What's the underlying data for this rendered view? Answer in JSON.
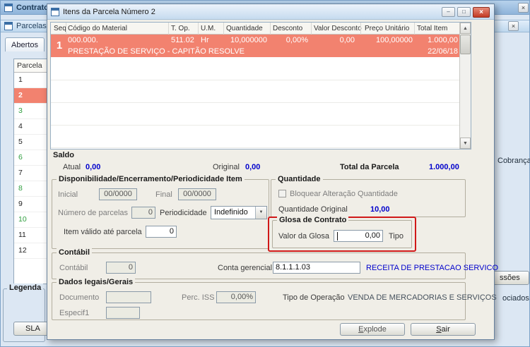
{
  "colors": {
    "selection_salmon": "#f2826f",
    "value_blue": "#0000cc",
    "annotation_red": "#d01818",
    "green_row": "#2f9e3e"
  },
  "icons": {
    "close": "×",
    "minimize": "–",
    "maximize": "□",
    "scroll_up": "▲",
    "scroll_down": "▼",
    "combo_arrow": "▼"
  },
  "background_window": {
    "title": "Contratos",
    "panel_title": "Parcelas do",
    "tab": "Abertos",
    "list_header": "Parcela",
    "parcelas": [
      {
        "num": "1",
        "state": "normal"
      },
      {
        "num": "2",
        "state": "selected"
      },
      {
        "num": "3",
        "state": "green"
      },
      {
        "num": "4",
        "state": "normal"
      },
      {
        "num": "5",
        "state": "normal"
      },
      {
        "num": "6",
        "state": "green"
      },
      {
        "num": "7",
        "state": "normal"
      },
      {
        "num": "8",
        "state": "green"
      },
      {
        "num": "9",
        "state": "normal"
      },
      {
        "num": "10",
        "state": "green"
      },
      {
        "num": "11",
        "state": "normal"
      },
      {
        "num": "12",
        "state": "normal"
      }
    ],
    "legenda": "Legenda",
    "sla_button": "SLA",
    "cobranca": "Cobrança",
    "ssoes_button": "ssões",
    "ociados": "ociados"
  },
  "dialog": {
    "title": "Itens da Parcela Número 2",
    "grid": {
      "columns": [
        "Seq",
        "Código do Material",
        "T. Op.",
        "U.M.",
        "Quantidade",
        "Desconto",
        "Valor Desconto",
        "Preço Unitário",
        "Total Item"
      ],
      "row": {
        "seq": "1",
        "codigo": "000.000.",
        "t_op": "511.02",
        "um": "Hr",
        "quantidade": "10,000000",
        "desconto": "0,00%",
        "valor_desconto": "0,00",
        "preco_unitario": "100,00000",
        "total_item": "1.000,00",
        "descricao": "PRESTAÇÃO DE SERVIÇO - CAPITÃO RESOLVE",
        "data": "22/06/18"
      }
    },
    "saldo": {
      "title": "Saldo",
      "atual_label": "Atual",
      "atual_value": "0,00",
      "original_label": "Original",
      "original_value": "0,00",
      "total_label": "Total da Parcela",
      "total_value": "1.000,00"
    },
    "disponibilidade": {
      "title": "Disponibilidade/Encerramento/Periodicidade Item",
      "inicial_label": "Inicial",
      "inicial_value": "00/0000",
      "final_label": "Final",
      "final_value": "00/0000",
      "num_parcelas_label": "Número de parcelas",
      "num_parcelas_value": "0",
      "periodicidade_label": "Periodicidade",
      "periodicidade_value": "Indefinido",
      "item_valido_label": "Item válido até parcela",
      "item_valido_value": "0"
    },
    "quantidade": {
      "title": "Quantidade",
      "bloquear_label": "Bloquear Alteração Quantidade",
      "original_label": "Quantidade Original",
      "original_value": "10,00"
    },
    "glosa": {
      "title": "Glosa de Contrato",
      "valor_label": "Valor da Glosa",
      "valor_value": "0,00",
      "tipo_label": "Tipo"
    },
    "contabil": {
      "title": "Contábil",
      "contabil_label": "Contábil",
      "contabil_value": "0",
      "conta_gerencial_label": "Conta gerencial",
      "conta_gerencial_value": "8.1.1.1.03",
      "conta_gerencial_desc": "RECEITA DE PRESTACAO SERVICO"
    },
    "dados_legais": {
      "title": "Dados legais/Gerais",
      "documento_label": "Documento",
      "documento_value": "",
      "perc_iss_label": "Perc. ISS",
      "perc_iss_value": "0,00%",
      "tipo_operacao_label": "Tipo de Operação",
      "tipo_operacao_value": "VENDA DE MERCADORIAS E SERVIÇOS",
      "especif1_label": "Especif1",
      "especif1_value": ""
    },
    "buttons": {
      "explode_accel": "E",
      "explode_rest": "xplode",
      "sair_accel": "S",
      "sair_rest": "air"
    }
  }
}
